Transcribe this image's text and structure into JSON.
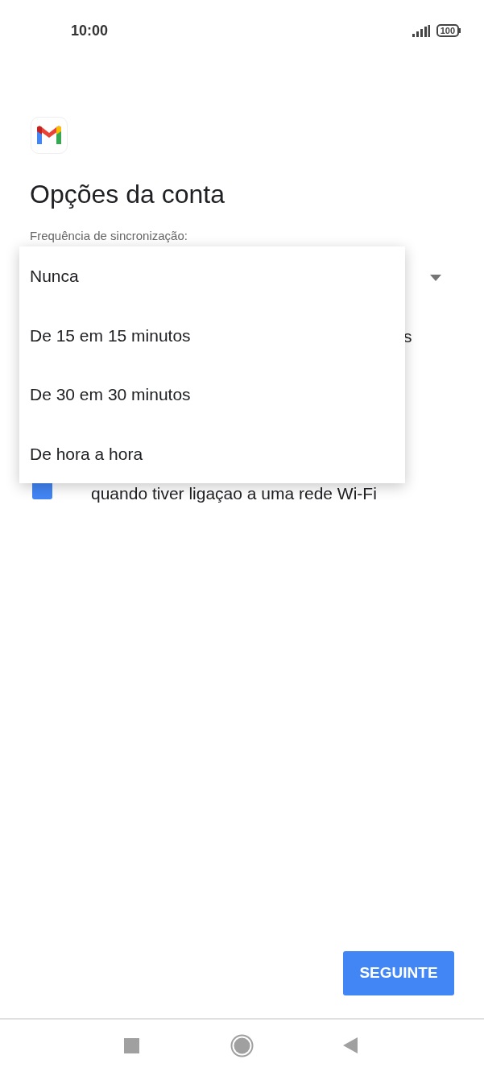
{
  "status_bar": {
    "time": "10:00",
    "battery": "100"
  },
  "title": "Opções da conta",
  "sync_frequency": {
    "label": "Frequência de sincronização:"
  },
  "hidden_text_fragment": "s",
  "wifi_option": {
    "checked": true,
    "text": "quando tiver ligaçao a uma rede Wi-Fi"
  },
  "dropdown_menu": {
    "items": [
      {
        "label": "Nunca"
      },
      {
        "label": "De 15 em 15 minutos"
      },
      {
        "label": "De 30 em 30 minutos"
      },
      {
        "label": "De hora a hora"
      }
    ]
  },
  "next_button": "SEGUINTE"
}
